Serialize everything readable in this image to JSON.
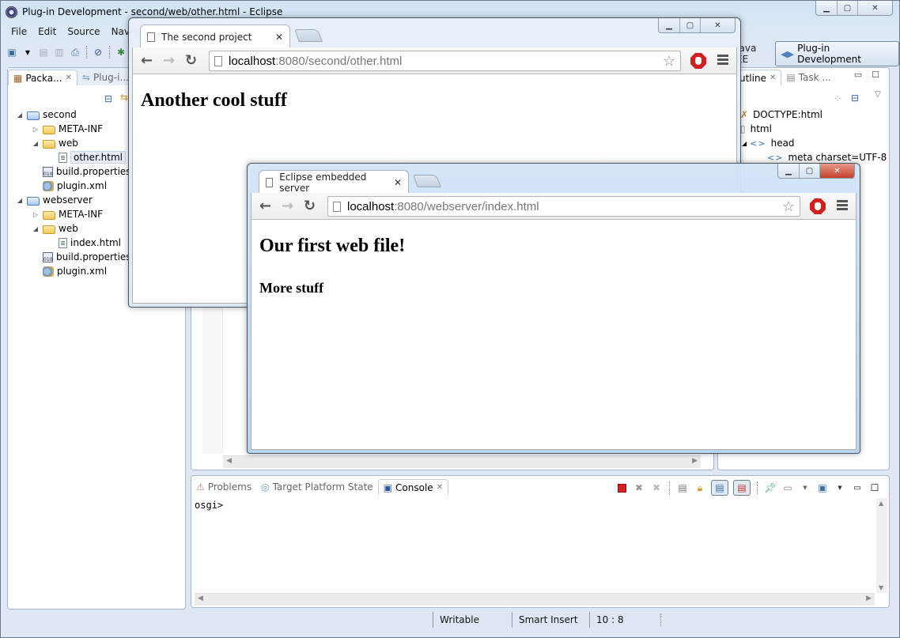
{
  "eclipse": {
    "title": "Plug-in Development - second/web/other.html - Eclipse",
    "menu": [
      "File",
      "Edit",
      "Source",
      "Navigate"
    ],
    "perspectives": {
      "other": "Java EE",
      "active": "Plug-in Development"
    },
    "package_explorer": {
      "tabs": [
        {
          "label": "Packa...",
          "active": true
        },
        {
          "label": "Plug-i...",
          "active": false
        }
      ],
      "tree": [
        {
          "label": "second",
          "type": "project",
          "level": 0,
          "expanded": true
        },
        {
          "label": "META-INF",
          "type": "folder",
          "level": 1,
          "expanded": false
        },
        {
          "label": "web",
          "type": "folder",
          "level": 1,
          "expanded": true
        },
        {
          "label": "other.html",
          "type": "html",
          "level": 2,
          "selected": true
        },
        {
          "label": "build.properties",
          "type": "properties",
          "level": 1
        },
        {
          "label": "plugin.xml",
          "type": "plugin",
          "level": 1
        },
        {
          "label": "webserver",
          "type": "project",
          "level": 0,
          "expanded": true
        },
        {
          "label": "META-INF",
          "type": "folder",
          "level": 1,
          "expanded": false
        },
        {
          "label": "web",
          "type": "folder",
          "level": 1,
          "expanded": true
        },
        {
          "label": "index.html",
          "type": "html",
          "level": 2
        },
        {
          "label": "build.properties",
          "type": "properties",
          "level": 1
        },
        {
          "label": "plugin.xml",
          "type": "plugin",
          "level": 1
        }
      ]
    },
    "outline": {
      "tabs": [
        {
          "label": "Outline",
          "active": true,
          "visible_label": "utline"
        },
        {
          "label": "Task ...",
          "active": false
        }
      ],
      "rows": [
        {
          "label": "DOCTYPE:html",
          "icon": "doctype-icon",
          "level": 0
        },
        {
          "label": "html",
          "icon": "html-element-icon",
          "level": 0
        },
        {
          "label": "head",
          "icon": "tag-icon",
          "level": 1,
          "expanded": true
        },
        {
          "label": "meta charset=UTF-8",
          "icon": "tag-icon",
          "level": 2
        }
      ]
    },
    "console": {
      "tabs": [
        {
          "label": "Problems",
          "active": false
        },
        {
          "label": "Target Platform State",
          "active": false
        },
        {
          "label": "Console",
          "active": true
        }
      ],
      "text": "osgi>"
    },
    "status": {
      "writable": "Writable",
      "insert_mode": "Smart Insert",
      "position": "10 : 8"
    }
  },
  "browsers": [
    {
      "id": "second",
      "tab_title": "The second project",
      "url_host": "localhost",
      "url_rest": ":8080/second/other.html",
      "content": {
        "h1": "Another cool stuff"
      }
    },
    {
      "id": "webserver",
      "tab_title": "Eclipse embedded server",
      "url_host": "localhost",
      "url_rest": ":8080/webserver/index.html",
      "content": {
        "h1": "Our first web file!",
        "h2": "More stuff"
      }
    }
  ],
  "colors": {
    "stop_red": "#d21f1f",
    "close_red": "#c4402c",
    "window_frame": "#cfe3f6"
  }
}
